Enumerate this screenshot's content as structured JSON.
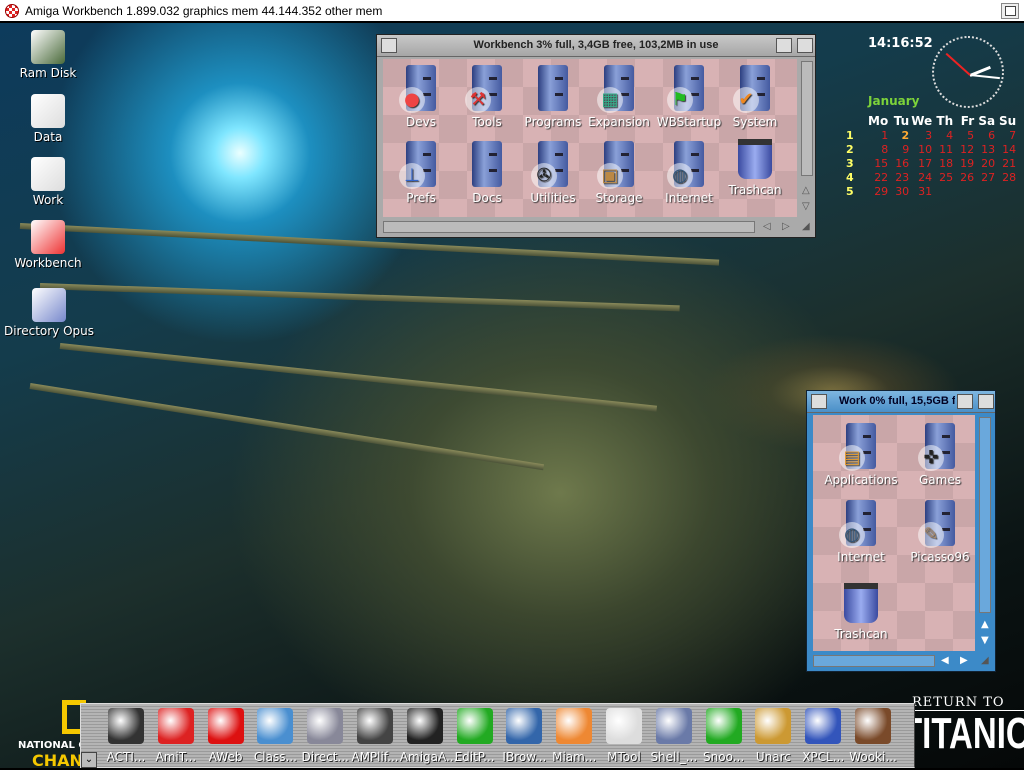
{
  "screen_title": "Amiga Workbench  1.899.032 graphics mem  44.144.352 other mem",
  "desktop_icons": [
    {
      "label": "Ram Disk",
      "icon": "ram-chip-icon",
      "color": "#4a6a3a"
    },
    {
      "label": "Data",
      "icon": "drive-icon",
      "color": "#ddd"
    },
    {
      "label": "Work",
      "icon": "drive-icon",
      "color": "#ddd"
    },
    {
      "label": "Workbench",
      "icon": "boing-ball-drive-icon",
      "color": "#e33"
    },
    {
      "label": "Directory Opus",
      "icon": "opus-icon",
      "color": "#7788cc"
    }
  ],
  "workbench_window": {
    "title": "Workbench  3% full, 3,4GB free, 103,2MB in use",
    "icons": [
      {
        "label": "Devs",
        "emblem": "boing-ball",
        "glyph": "●",
        "color": "#e44"
      },
      {
        "label": "Tools",
        "emblem": "hammer",
        "glyph": "⚒",
        "color": "#d33"
      },
      {
        "label": "Programs",
        "emblem": "",
        "glyph": "",
        "color": ""
      },
      {
        "label": "Expansion",
        "emblem": "circuit-board",
        "glyph": "▦",
        "color": "#3a8"
      },
      {
        "label": "WBStartup",
        "emblem": "flag",
        "glyph": "⚑",
        "color": "#2b2"
      },
      {
        "label": "System",
        "emblem": "checkmark",
        "glyph": "✔",
        "color": "#e82"
      },
      {
        "label": "Prefs",
        "emblem": "prefs-globe",
        "glyph": "⊥",
        "color": "#36c"
      },
      {
        "label": "Docs",
        "emblem": "",
        "glyph": "",
        "color": ""
      },
      {
        "label": "Utilities",
        "emblem": "film-reel",
        "glyph": "✇",
        "color": "#222"
      },
      {
        "label": "Storage",
        "emblem": "box",
        "glyph": "▣",
        "color": "#b84"
      },
      {
        "label": "Internet",
        "emblem": "globe",
        "glyph": "◍",
        "color": "#357"
      },
      {
        "label": "Trashcan",
        "emblem": "trashcan",
        "glyph": "",
        "color": ""
      }
    ]
  },
  "work_window": {
    "title": "Work  0% full, 15,5GB f",
    "icons": [
      {
        "label": "Applications",
        "emblem": "floppy",
        "glyph": "▤",
        "color": "#d93"
      },
      {
        "label": "Games",
        "emblem": "gamepad",
        "glyph": "✜",
        "color": "#222"
      },
      {
        "label": "Internet",
        "emblem": "globe",
        "glyph": "◍",
        "color": "#357"
      },
      {
        "label": "Picasso96",
        "emblem": "desk-lamp",
        "glyph": "✎",
        "color": "#a86"
      },
      {
        "label": "Trashcan",
        "emblem": "trashcan",
        "glyph": "",
        "color": ""
      }
    ]
  },
  "clock": {
    "time": "14:16:52",
    "hour": 2,
    "minute": 16,
    "second": 52
  },
  "calendar": {
    "month": "January",
    "weekdays": [
      "Mo",
      "Tu",
      "We",
      "Th",
      "Fr",
      "Sa",
      "Su"
    ],
    "today": 2,
    "weeks": [
      {
        "num": "1",
        "days": [
          "1",
          "2",
          "3",
          "4",
          "5",
          "6",
          "7"
        ]
      },
      {
        "num": "2",
        "days": [
          "8",
          "9",
          "10",
          "11",
          "12",
          "13",
          "14"
        ]
      },
      {
        "num": "3",
        "days": [
          "15",
          "16",
          "17",
          "18",
          "19",
          "20",
          "21"
        ]
      },
      {
        "num": "4",
        "days": [
          "22",
          "23",
          "24",
          "25",
          "26",
          "27",
          "28"
        ]
      },
      {
        "num": "5",
        "days": [
          "29",
          "30",
          "31",
          "",
          "",
          "",
          ""
        ]
      }
    ]
  },
  "dock": {
    "handle": "⌄",
    "items": [
      {
        "label": "ACTI...",
        "color": "#333"
      },
      {
        "label": "AmiT...",
        "color": "#d22"
      },
      {
        "label": "AWeb",
        "color": "#d11"
      },
      {
        "label": "Class...",
        "color": "#4a8fd0"
      },
      {
        "label": "Direct...",
        "color": "#889"
      },
      {
        "label": "AMPlif...",
        "color": "#444"
      },
      {
        "label": "AmigaA...",
        "color": "#222"
      },
      {
        "label": "EditP...",
        "color": "#2a2"
      },
      {
        "label": "IBrow...",
        "color": "#36a"
      },
      {
        "label": "Miam...",
        "color": "#e83"
      },
      {
        "label": "MTool",
        "color": "#ddd"
      },
      {
        "label": "Shell_...",
        "color": "#6a7aa8"
      },
      {
        "label": "Snoo...",
        "color": "#2a2"
      },
      {
        "label": "Unarc",
        "color": "#c93"
      },
      {
        "label": "XPCL...",
        "color": "#35b"
      },
      {
        "label": "Wooki...",
        "color": "#7a4a2a"
      }
    ]
  },
  "logos": {
    "natgeo_line1": "NATIONAL GE",
    "natgeo_line2": "CHAN",
    "titanic_line1": "RETURN TO",
    "titanic_line2": "TITANIC"
  }
}
